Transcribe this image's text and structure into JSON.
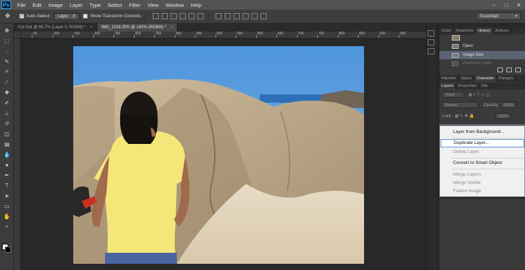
{
  "menubar": {
    "logo": "Ps",
    "items": [
      "File",
      "Edit",
      "Image",
      "Layer",
      "Type",
      "Select",
      "Filter",
      "View",
      "Window",
      "Help"
    ],
    "controls": [
      "–",
      "□",
      "✕"
    ]
  },
  "options": {
    "auto_select_label": "Auto-Select:",
    "auto_select_checked": true,
    "auto_select_target": "Layer",
    "show_transform_label": "Show Transform Controls",
    "workspace": "Essentials"
  },
  "document_tabs": [
    {
      "label": "Cut Out @ 66.7% (Layer 5, RGB/8) *",
      "active": false
    },
    {
      "label": "IMG_2228.JPG @ 100% (RGB/8) *",
      "active": true
    }
  ],
  "ruler": {
    "labels": [
      "50",
      "100",
      "150",
      "200",
      "250",
      "300",
      "350",
      "400",
      "450",
      "500",
      "550",
      "600",
      "650",
      "700",
      "750",
      "800",
      "850",
      "900",
      "950"
    ]
  },
  "panels": {
    "top_tabs": [
      "Color",
      "Swatches",
      "History",
      "Actions"
    ],
    "top_active": "History",
    "history": [
      {
        "label": "Open",
        "state": "normal"
      },
      {
        "label": "Image Size",
        "state": "selected"
      },
      {
        "label": "Duplicate Layer",
        "state": "dim"
      }
    ],
    "mid_tabs": [
      "Adjustm",
      "Styles",
      "Character",
      "Paragra"
    ],
    "mid_active": "Character",
    "layer_tabs": [
      "Layers",
      "Properties",
      "Info"
    ],
    "layer_active": "Layers",
    "kind_label": "Kind",
    "blend_mode": "Normal",
    "opacity_label": "Opacity:",
    "opacity_value": "100%",
    "lock_label": "Lock:",
    "fill_value": "100%"
  },
  "context_menu": {
    "items": [
      {
        "label": "Layer from Background...",
        "state": "normal"
      },
      {
        "label": "Duplicate Layer...",
        "state": "hover"
      },
      {
        "label": "Delete Layer",
        "state": "disabled"
      },
      {
        "label": "Convert to Smart Object",
        "state": "normal"
      },
      {
        "label": "Merge Layers",
        "state": "disabled"
      },
      {
        "label": "Merge Visible",
        "state": "disabled"
      },
      {
        "label": "Flatten Image",
        "state": "disabled"
      }
    ]
  },
  "colors": {
    "accent": "#31a8ff",
    "history_selected": "#5b6374",
    "menu_hover_border": "#5b8fd6"
  },
  "icons": [
    "move-tool-icon",
    "marquee-tool-icon",
    "lasso-tool-icon",
    "quick-select-icon",
    "crop-tool-icon",
    "eyedropper-icon",
    "healing-brush-icon",
    "brush-tool-icon",
    "clone-stamp-icon",
    "history-brush-icon",
    "eraser-icon",
    "gradient-icon",
    "blur-icon",
    "dodge-icon",
    "pen-tool-icon",
    "type-tool-icon",
    "path-select-icon",
    "rectangle-tool-icon",
    "hand-tool-icon",
    "zoom-tool-icon"
  ]
}
